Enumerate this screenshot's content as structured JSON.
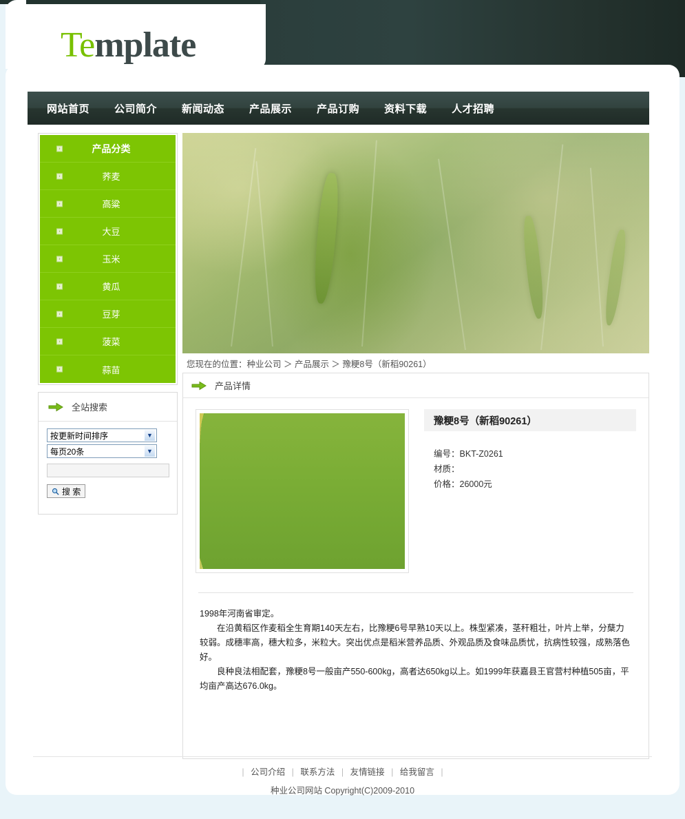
{
  "site": {
    "logo_prefix": "T",
    "logo_accent": "e",
    "logo_rest": "mplate"
  },
  "nav": {
    "items": [
      {
        "label": "网站首页"
      },
      {
        "label": "公司简介"
      },
      {
        "label": "新闻动态"
      },
      {
        "label": "产品展示"
      },
      {
        "label": "产品订购"
      },
      {
        "label": "资料下载"
      },
      {
        "label": "人才招聘"
      }
    ]
  },
  "sidebar": {
    "categories": {
      "header": "产品分类",
      "bullet_glyph": "›",
      "items": [
        {
          "label": "荞麦"
        },
        {
          "label": "高粱"
        },
        {
          "label": "大豆"
        },
        {
          "label": "玉米"
        },
        {
          "label": "黄瓜"
        },
        {
          "label": "豆芽"
        },
        {
          "label": "菠菜"
        },
        {
          "label": "蒜苗"
        }
      ]
    },
    "search": {
      "title": "全站搜索",
      "sort_select": {
        "value": "按更新时间排序",
        "options": [
          "按更新时间排序"
        ]
      },
      "pagesize_select": {
        "value": "每页20条",
        "options": [
          "每页20条"
        ]
      },
      "keyword_input": {
        "value": "",
        "placeholder": ""
      },
      "button_label": "搜 索",
      "arrow_glyph": "▼"
    }
  },
  "content": {
    "breadcrumb": "您现在的位置：种业公司  ＞ 产品展示  ＞ 豫粳8号（新稻90261）",
    "panel_title": "产品详情",
    "product": {
      "title": "豫粳8号（新稻90261）",
      "fields": [
        {
          "label": "编号：",
          "value": "BKT-Z0261"
        },
        {
          "label": "材质：",
          "value": ""
        },
        {
          "label": "价格：",
          "value": "26000元"
        }
      ],
      "description": [
        "1998年河南省审定。",
        "在沿黄稻区作麦稻全生育期140天左右，比豫粳6号早熟10天以上。株型紧凑，茎秆粗壮，叶片上举，分蘖力较弱。成穗率高，穗大粒多，米粒大。突出优点是稻米营养品质、外观品质及食味品质忧，抗病性较强，成熟落色好。",
        "良种良法相配套，豫粳8号一般亩产550-600kg，高者达650kg以上。如1999年获嘉县王官营村种植505亩，平均亩产高达676.0kg。"
      ]
    }
  },
  "footer": {
    "links": [
      {
        "label": "公司介绍"
      },
      {
        "label": "联系方法"
      },
      {
        "label": "友情链接"
      },
      {
        "label": "给我留言"
      }
    ],
    "separator": "|",
    "copyright": "种业公司网站  Copyright(C)2009-2010"
  },
  "colors": {
    "brand_green": "#7dc503",
    "header_dark": "#2b3e3c",
    "page_bg": "#e9f4f9"
  }
}
